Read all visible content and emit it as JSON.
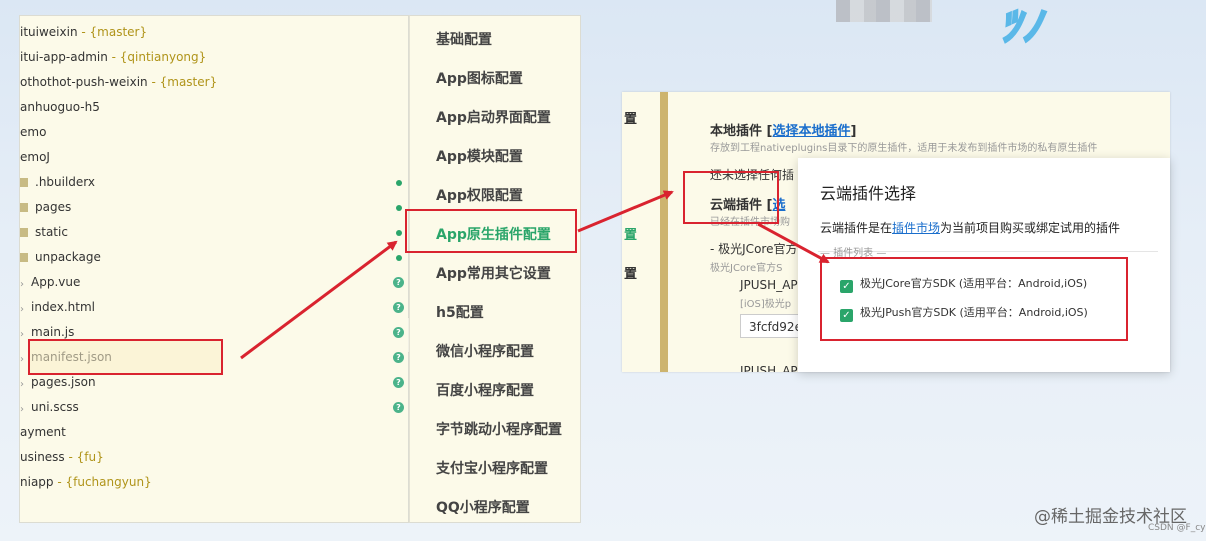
{
  "file_tree": {
    "items": [
      {
        "name": "ituiweixin",
        "branch": " - {master}",
        "icon": "",
        "dot": ""
      },
      {
        "name": "itui-app-admin",
        "branch": " - {qintianyong}",
        "icon": "",
        "dot": ""
      },
      {
        "name": "othothot-push-weixin",
        "branch": " - {master}",
        "icon": "",
        "dot": ""
      },
      {
        "name": "anhuoguo-h5",
        "branch": "",
        "icon": "",
        "dot": ""
      },
      {
        "name": "emo",
        "branch": "",
        "icon": "",
        "dot": ""
      },
      {
        "name": "emoJ",
        "branch": "",
        "icon": "",
        "dot": ""
      },
      {
        "name": ".hbuilderx",
        "branch": "",
        "icon": "folder",
        "dot": "modified"
      },
      {
        "name": "pages",
        "branch": "",
        "icon": "folder",
        "dot": "modified"
      },
      {
        "name": "static",
        "branch": "",
        "icon": "folder",
        "dot": "modified"
      },
      {
        "name": "unpackage",
        "branch": "",
        "icon": "folder",
        "dot": "modified"
      },
      {
        "name": "App.vue",
        "branch": "",
        "icon": "file",
        "dot": "untracked"
      },
      {
        "name": "index.html",
        "branch": "",
        "icon": "file",
        "dot": "untracked"
      },
      {
        "name": "main.js",
        "branch": "",
        "icon": "file",
        "dot": "untracked"
      },
      {
        "name": "manifest.json",
        "branch": "",
        "icon": "file",
        "dot": "untracked"
      },
      {
        "name": "pages.json",
        "branch": "",
        "icon": "file",
        "dot": "untracked"
      },
      {
        "name": "uni.scss",
        "branch": "",
        "icon": "file",
        "dot": "untracked"
      },
      {
        "name": "ayment",
        "branch": "",
        "icon": "",
        "dot": ""
      },
      {
        "name": "usiness",
        "branch": " - {fu}",
        "icon": "",
        "dot": ""
      },
      {
        "name": "niapp",
        "branch": " - {fuchangyun}",
        "icon": "",
        "dot": ""
      }
    ],
    "untracked_mark": "?"
  },
  "config_menu": {
    "items": [
      {
        "label": "基础配置"
      },
      {
        "label": "App图标配置"
      },
      {
        "label": "App启动界面配置"
      },
      {
        "label": "App模块配置"
      },
      {
        "label": "App权限配置"
      },
      {
        "label": "App原生插件配置",
        "active": true
      },
      {
        "label": "App常用其它设置"
      },
      {
        "label": "h5配置"
      },
      {
        "label": "微信小程序配置"
      },
      {
        "label": "百度小程序配置"
      },
      {
        "label": "字节跳动小程序配置"
      },
      {
        "label": "支付宝小程序配置"
      },
      {
        "label": "QQ小程序配置"
      }
    ],
    "active_color": "#2aa56a"
  },
  "plugin_panel": {
    "left_stubs": [
      "置",
      "置",
      "置"
    ],
    "local_label": "本地插件",
    "local_link": "选择本地插件",
    "local_desc": "存放到工程nativeplugins目录下的原生插件，适用于未发布到插件市场的私有原生插件",
    "no_select": "还未选择任何插",
    "cloud_label": "云端插件",
    "cloud_link": "选",
    "cloud_desc": "已经在插件市场购",
    "jcore_title": "- 极光JCore官方",
    "jcore_desc": "极光JCore官方S",
    "jpush_key": "JPUSH_AP",
    "jpush_key_desc": "[iOS]极光p",
    "appkey_value": "3fcfd92e",
    "jpush_key2": "JPUSH_AP"
  },
  "dialog": {
    "title": "云端插件选择",
    "desc_before": "云端插件是在",
    "desc_link": "插件市场",
    "desc_after": "为当前项目购买或绑定试用的插件",
    "legend": "插件列表",
    "plugins": [
      {
        "label": "极光JCore官方SDK (适用平台：Android,iOS)",
        "checked": true
      },
      {
        "label": "极光JPush官方SDK (适用平台：Android,iOS)",
        "checked": true
      }
    ]
  },
  "watermark": {
    "main": "@稀土掘金技术社区",
    "sub": "CSDN @F_cy"
  },
  "colors": {
    "highlight": "#d9232f",
    "accent": "#2aa56a",
    "link": "#1a6ecc",
    "panel_bg": "#fcfae9"
  }
}
